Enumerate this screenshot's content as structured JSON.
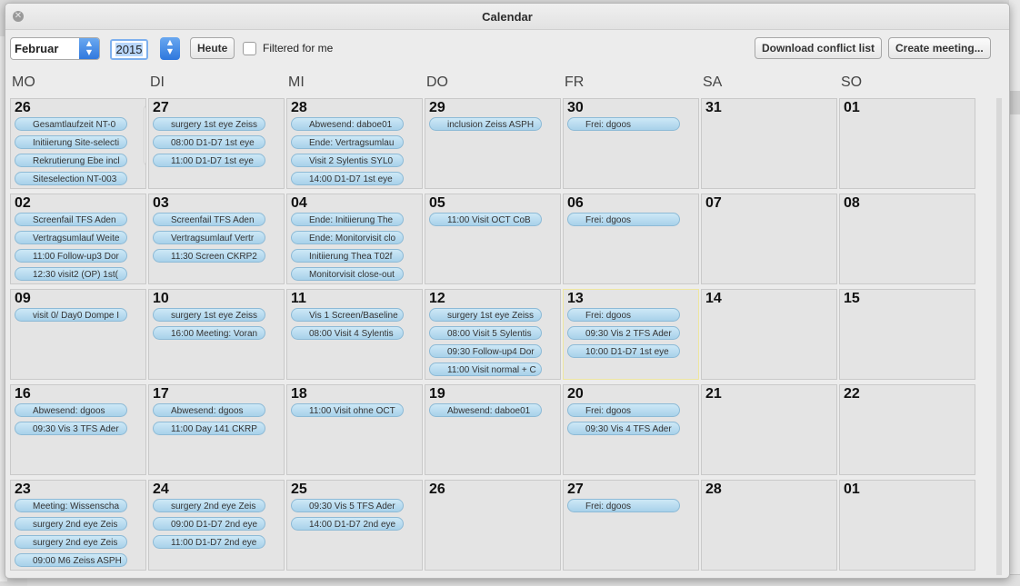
{
  "window": {
    "title": "Calendar"
  },
  "toolbar": {
    "month": "Februar",
    "year": "2015",
    "today_label": "Heute",
    "filter_label": "Filtered for me",
    "conflict_label": "Download conflict list",
    "create_label": "Create meeting..."
  },
  "weekdays": [
    "MO",
    "DI",
    "MI",
    "DO",
    "FR",
    "SA",
    "SO"
  ],
  "weeks": [
    [
      {
        "day": "26",
        "events": [
          "Gesamtlaufzeit  NT-0",
          "Initiierung Site-selecti",
          "Rekrutierung Ebe incl",
          "Siteselection  NT-003"
        ]
      },
      {
        "day": "27",
        "events": [
          "surgery 1st eye Zeiss",
          "08:00 D1-D7 1st eye",
          "11:00 D1-D7 1st eye"
        ]
      },
      {
        "day": "28",
        "events": [
          "Abwesend: daboe01",
          "Ende: Vertragsumlau",
          "Visit 2 Sylentis SYL0",
          "14:00 D1-D7 1st eye"
        ]
      },
      {
        "day": "29",
        "events": [
          "inclusion Zeiss ASPH"
        ]
      },
      {
        "day": "30",
        "events": [
          "Frei: dgoos"
        ]
      },
      {
        "day": "31",
        "events": []
      },
      {
        "day": "01",
        "events": []
      }
    ],
    [
      {
        "day": "02",
        "events": [
          "Screenfail TFS Aden",
          "Vertragsumlauf Weite",
          "11:00 Follow-up3 Dor",
          "12:30 visit2 (OP) 1st("
        ]
      },
      {
        "day": "03",
        "events": [
          "Screenfail TFS Aden",
          "Vertragsumlauf Vertr",
          "11:30 Screen CKRP2"
        ]
      },
      {
        "day": "04",
        "events": [
          "Ende: Initiierung  The",
          "Ende: Monitorvisit clo",
          "Initiierung  Thea T02f",
          "Monitorvisit close-out"
        ]
      },
      {
        "day": "05",
        "events": [
          "11:00 Visit OCT CoB"
        ]
      },
      {
        "day": "06",
        "events": [
          "Frei: dgoos"
        ]
      },
      {
        "day": "07",
        "events": []
      },
      {
        "day": "08",
        "events": []
      }
    ],
    [
      {
        "day": "09",
        "events": [
          "visit 0/ Day0 Dompe I"
        ]
      },
      {
        "day": "10",
        "events": [
          "surgery 1st eye Zeiss",
          "16:00 Meeting: Voran"
        ]
      },
      {
        "day": "11",
        "events": [
          "Vis 1 Screen/Baseline",
          "08:00 Visit 4 Sylentis"
        ]
      },
      {
        "day": "12",
        "events": [
          "surgery 1st eye Zeiss",
          "08:00 Visit 5 Sylentis",
          "09:30 Follow-up4 Dor",
          "11:00 Visit normal + C"
        ]
      },
      {
        "day": "13",
        "events": [
          "Frei: dgoos",
          "09:30 Vis 2 TFS Ader",
          "10:00 D1-D7 1st eye"
        ],
        "selected": true
      },
      {
        "day": "14",
        "events": []
      },
      {
        "day": "15",
        "events": []
      }
    ],
    [
      {
        "day": "16",
        "events": [
          "Abwesend: dgoos",
          "09:30 Vis 3 TFS Ader"
        ]
      },
      {
        "day": "17",
        "events": [
          "Abwesend: dgoos",
          "11:00 Day 141 CKRP"
        ]
      },
      {
        "day": "18",
        "events": [
          "11:00 Visit ohne OCT"
        ]
      },
      {
        "day": "19",
        "events": [
          "Abwesend: daboe01"
        ]
      },
      {
        "day": "20",
        "events": [
          "Frei: dgoos",
          "09:30 Vis 4 TFS Ader"
        ]
      },
      {
        "day": "21",
        "events": []
      },
      {
        "day": "22",
        "events": []
      }
    ],
    [
      {
        "day": "23",
        "events": [
          "Meeting: Wissenscha",
          "surgery 2nd eye Zeis",
          "surgery 2nd eye Zeis",
          "09:00 M6 Zeiss ASPH"
        ]
      },
      {
        "day": "24",
        "events": [
          "surgery 2nd eye Zeis",
          "09:00 D1-D7 2nd eye",
          "11:00 D1-D7 2nd eye"
        ]
      },
      {
        "day": "25",
        "events": [
          "09:30 Vis 5 TFS Ader",
          "14:00 D1-D7 2nd eye"
        ]
      },
      {
        "day": "26",
        "events": []
      },
      {
        "day": "27",
        "events": [
          "Frei: dgoos"
        ]
      },
      {
        "day": "28",
        "events": []
      },
      {
        "day": "01",
        "events": []
      }
    ]
  ],
  "icons": {
    "close": "close-icon",
    "month_stepper": "up-down-arrows-icon",
    "year_stepper": "up-down-arrows-icon"
  }
}
